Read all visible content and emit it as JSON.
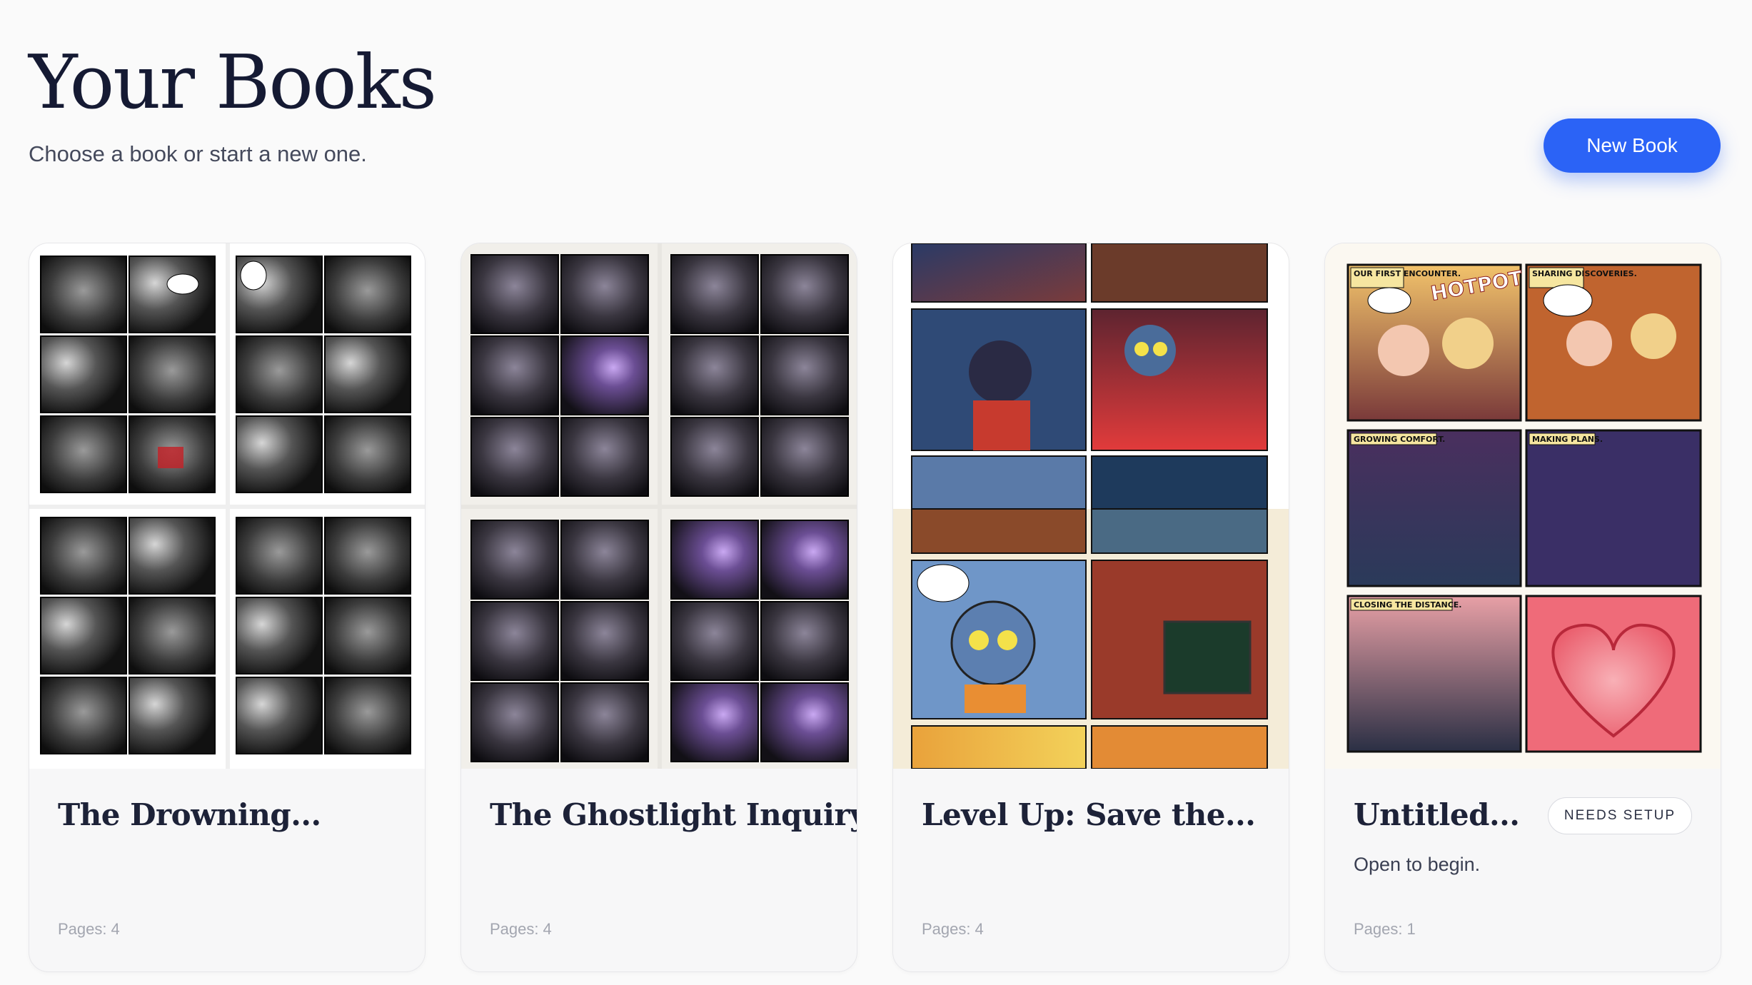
{
  "header": {
    "title": "Your Books",
    "subtitle": "Choose a book or start a new one."
  },
  "actions": {
    "new_book_label": "New Book"
  },
  "books": [
    {
      "title": "The Drowning...",
      "pages_label": "Pages:",
      "pages": "4",
      "style": "noir-bw"
    },
    {
      "title": "The Ghostlight Inquiry",
      "pages_label": "Pages:",
      "pages": "4",
      "style": "noir-purple"
    },
    {
      "title": "Level Up: Save the...",
      "pages_label": "Pages:",
      "pages": "4",
      "style": "arcade-color"
    },
    {
      "title": "Untitled...",
      "pages_label": "Pages:",
      "pages": "1",
      "style": "romance-color",
      "badge": "NEEDS SETUP",
      "description": "Open to begin.",
      "panel_captions": [
        "OUR FIRST ENCOUNTER.",
        "SHARING DISCOVERIES.",
        "GROWING COMFORT.",
        "MAKING PLANS.",
        "CLOSING THE DISTANCE."
      ],
      "sign_text": "HOTPOT"
    }
  ],
  "colors": {
    "accent": "#2b63f6",
    "title": "#151a33",
    "muted": "#a3a6b0"
  }
}
